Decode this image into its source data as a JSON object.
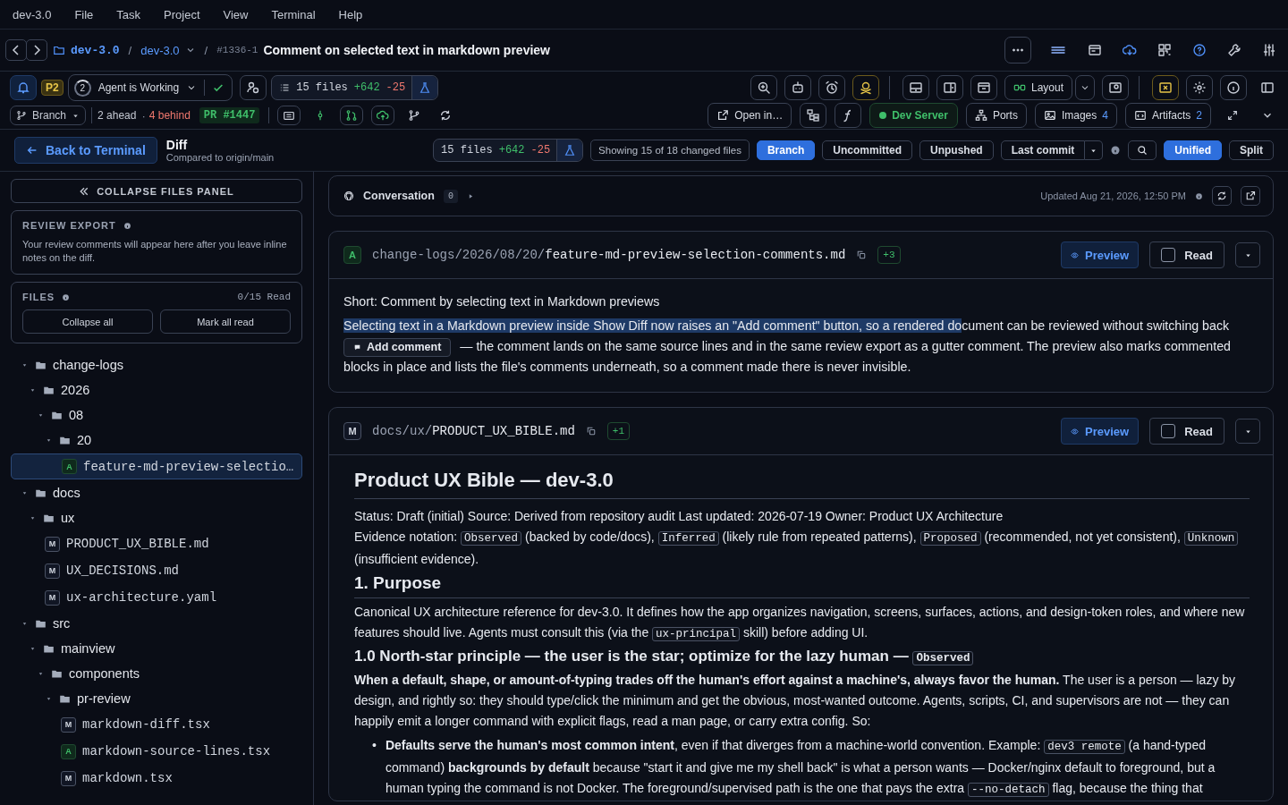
{
  "menu_bar": [
    "dev-3.0",
    "File",
    "Task",
    "Project",
    "View",
    "Terminal",
    "Help"
  ],
  "title_bar": {
    "separators": [
      "/",
      "/"
    ],
    "repo": "dev-3.0",
    "branch": "dev-3.0",
    "task_id": "#1336-1",
    "task_title": "Comment on selected text in markdown preview"
  },
  "agent_bar": {
    "priority": "P2",
    "agent_count": "2",
    "agent_status": "Agent is Working",
    "files": "15 files",
    "additions": "+642",
    "deletions": "-25",
    "layout": "Layout"
  },
  "git_bar": {
    "branch": "Branch",
    "ahead": "2 ahead",
    "dot": "·",
    "behind": "4 behind",
    "pr": "PR #1447",
    "open_in": "Open in…",
    "dev_server": "Dev Server",
    "ports": "Ports",
    "images": "Images",
    "images_count": "4",
    "artifacts": "Artifacts",
    "artifacts_count": "2"
  },
  "diff_header": {
    "back": "Back to Terminal",
    "title": "Diff",
    "subtitle": "Compared to origin/main",
    "files": "15 files",
    "additions": "+642",
    "deletions": "-25",
    "showing": "Showing 15 of 18 changed files",
    "scope_tabs": [
      {
        "label": "Branch",
        "selected": true,
        "menu": false
      },
      {
        "label": "Uncommitted",
        "selected": false,
        "menu": false
      },
      {
        "label": "Unpushed",
        "selected": false,
        "menu": false
      },
      {
        "label": "Last commit",
        "selected": false,
        "menu": true
      }
    ],
    "view_tabs": [
      {
        "label": "Unified",
        "selected": true
      },
      {
        "label": "Split",
        "selected": false
      }
    ]
  },
  "sidebar": {
    "collapse": "COLLAPSE FILES PANEL",
    "review_title": "REVIEW EXPORT",
    "review_text": "Your review comments will appear here after you leave inline notes on the diff.",
    "files_title": "FILES",
    "read_count": "0/15 Read",
    "buttons": [
      "Collapse all",
      "Mark all read"
    ],
    "tree": [
      {
        "kind": "folder",
        "name": "change-logs",
        "expanded": true,
        "children": [
          {
            "kind": "folder",
            "name": "2026",
            "expanded": true,
            "children": [
              {
                "kind": "folder",
                "name": "08",
                "expanded": true,
                "children": [
                  {
                    "kind": "folder",
                    "name": "20",
                    "expanded": true,
                    "children": [
                      {
                        "kind": "file",
                        "name": "feature-md-preview-selectio…",
                        "status": "A",
                        "selected": true
                      }
                    ]
                  }
                ]
              }
            ]
          }
        ]
      },
      {
        "kind": "folder",
        "name": "docs",
        "expanded": true,
        "children": [
          {
            "kind": "folder",
            "name": "ux",
            "expanded": true,
            "children": [
              {
                "kind": "file",
                "name": "PRODUCT_UX_BIBLE.md",
                "status": "M",
                "selected": false
              },
              {
                "kind": "file",
                "name": "UX_DECISIONS.md",
                "status": "M",
                "selected": false
              },
              {
                "kind": "file",
                "name": "ux-architecture.yaml",
                "status": "M",
                "selected": false
              }
            ]
          }
        ]
      },
      {
        "kind": "folder",
        "name": "src",
        "expanded": true,
        "children": [
          {
            "kind": "folder",
            "name": "mainview",
            "expanded": true,
            "children": [
              {
                "kind": "folder",
                "name": "components",
                "expanded": true,
                "children": [
                  {
                    "kind": "folder",
                    "name": "pr-review",
                    "expanded": true,
                    "children": [
                      {
                        "kind": "file",
                        "name": "markdown-diff.tsx",
                        "status": "M",
                        "selected": false
                      },
                      {
                        "kind": "file",
                        "name": "markdown-source-lines.tsx",
                        "status": "A",
                        "selected": false
                      },
                      {
                        "kind": "file",
                        "name": "markdown.tsx",
                        "status": "M",
                        "selected": false
                      }
                    ]
                  }
                ]
              }
            ]
          }
        ]
      }
    ]
  },
  "conversation": {
    "label": "Conversation",
    "count": "0",
    "updated": "Updated Aug 21, 2026, 12:50 PM"
  },
  "files": [
    {
      "kind": "note",
      "status": "A",
      "dir": "change-logs/2026/08/20/",
      "name": "feature-md-preview-selection-comments.md",
      "changes": "+3",
      "preview": "Preview",
      "read_label": "Read",
      "read": false,
      "short": "Short: Comment by selecting text in Markdown previews",
      "selection": "Selecting text in a Markdown preview inside Show Diff now raises an \"Add comment\" button, so a rendered do",
      "rest": "cument can be reviewed without switching back",
      "popup": "Add comment",
      "after_popup": "— the comment lands on the same source lines and in the same review export as a gutter comment. The preview also marks commented",
      "last_line": "blocks in place and lists the file's comments underneath, so a comment made there is never invisible."
    },
    {
      "kind": "markdown",
      "status": "M",
      "dir": "docs/ux/",
      "name": "PRODUCT_UX_BIBLE.md",
      "changes": "+1",
      "preview": "Preview",
      "read_label": "Read",
      "read": false,
      "blocks": [
        {
          "kind": "h1",
          "parts": [
            {
              "kind": "text",
              "text": "Product UX Bible — dev-3.0"
            }
          ]
        },
        {
          "kind": "line",
          "parts": [
            {
              "kind": "text",
              "text": "Status: Draft (initial) Source: Derived from repository audit Last updated: 2026-07-19 Owner: Product UX Architecture"
            }
          ]
        },
        {
          "kind": "p",
          "parts": [
            {
              "kind": "text",
              "text": "Evidence notation: "
            },
            {
              "kind": "code",
              "text": "Observed"
            },
            {
              "kind": "text",
              "text": " (backed by code/docs), "
            },
            {
              "kind": "code",
              "text": "Inferred"
            },
            {
              "kind": "text",
              "text": " (likely rule from repeated patterns), "
            },
            {
              "kind": "code",
              "text": "Proposed"
            },
            {
              "kind": "text",
              "text": " (recommended, not yet consistent), "
            },
            {
              "kind": "code",
              "text": "Unknown"
            },
            {
              "kind": "text",
              "text": " (insufficient evidence)."
            }
          ]
        },
        {
          "kind": "h2",
          "parts": [
            {
              "kind": "text",
              "text": "1. Purpose"
            }
          ]
        },
        {
          "kind": "p",
          "parts": [
            {
              "kind": "text",
              "text": "Canonical UX architecture reference for dev-3.0. It defines how the app organizes navigation, screens, surfaces, actions, and design-token roles, and where new features should live. Agents must consult this (via the "
            },
            {
              "kind": "code",
              "text": "ux-principal"
            },
            {
              "kind": "text",
              "text": " skill) before adding UI."
            }
          ]
        },
        {
          "kind": "h3",
          "parts": [
            {
              "kind": "text",
              "text": "1.0 North-star principle — the user is the star; optimize for the lazy human — "
            },
            {
              "kind": "code",
              "text": "Observed"
            }
          ]
        },
        {
          "kind": "p",
          "parts": [
            {
              "kind": "text",
              "text": "**When a default, shape, or amount-of-typing trades off the human's effort against a machine's, always favor the human.** The user is a person — lazy by design, and rightly so: they should type/click the minimum and get the obvious, most-wanted outcome. Agents, scripts, CI, and supervisors are not — they can happily emit a longer command with explicit flags, read a man page, or carry extra config. So:"
            }
          ]
        },
        {
          "kind": "li",
          "marker": "•",
          "parts": [
            {
              "kind": "text",
              "text": "**Defaults serve the human's most common intent**, even if that diverges from a machine-world convention. Example: "
            },
            {
              "kind": "code",
              "text": "dev3 remote"
            },
            {
              "kind": "text",
              "text": " (a hand-typed command) **backgrounds by default** because \"start it and give me my shell back\" is what a person wants — Docker/nginx default to foreground, but a human typing the command is not Docker. The foreground/supervised path is the one that pays the extra "
            },
            {
              "kind": "code",
              "text": "--no-detach"
            },
            {
              "kind": "text",
              "text": " flag, because the thing that"
            }
          ]
        }
      ]
    }
  ]
}
